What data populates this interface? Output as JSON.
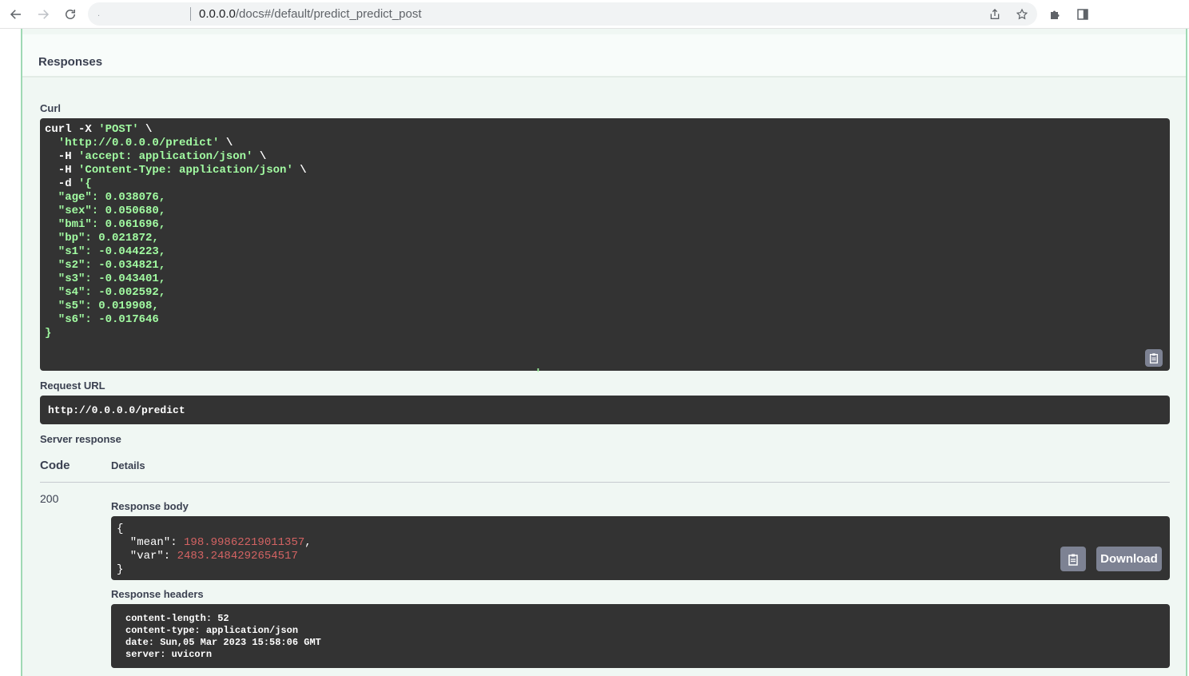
{
  "browser": {
    "url_prefix": ".",
    "url_host": "0.0.0.0",
    "url_path": "/docs#/default/predict_predict_post",
    "icons": [
      "back-arrow-icon",
      "forward-arrow-icon",
      "reload-icon",
      "share-icon",
      "star-icon",
      "extensions-puzzle-icon",
      "sidepanel-icon"
    ]
  },
  "responses": {
    "title": "Responses"
  },
  "curl": {
    "label": "Curl",
    "lines": [
      {
        "pre": "curl -X ",
        "str": "'POST'",
        "post": " \\"
      },
      {
        "pre": "  ",
        "str": "'http://0.0.0.0/predict'",
        "post": " \\"
      },
      {
        "pre": "  -H ",
        "str": "'accept: application/json'",
        "post": " \\"
      },
      {
        "pre": "  -H ",
        "str": "'Content-Type: application/json'",
        "post": " \\"
      },
      {
        "pre": "  -d ",
        "str": "'{",
        "post": ""
      },
      {
        "pre": "",
        "str": "  \"age\": 0.038076,",
        "post": ""
      },
      {
        "pre": "",
        "str": "  \"sex\": 0.050680,",
        "post": ""
      },
      {
        "pre": "",
        "str": "  \"bmi\": 0.061696,",
        "post": ""
      },
      {
        "pre": "",
        "str": "  \"bp\": 0.021872,",
        "post": ""
      },
      {
        "pre": "",
        "str": "  \"s1\": -0.044223,",
        "post": ""
      },
      {
        "pre": "",
        "str": "  \"s2\": -0.034821,",
        "post": ""
      },
      {
        "pre": "",
        "str": "  \"s3\": -0.043401,",
        "post": ""
      },
      {
        "pre": "",
        "str": "  \"s4\": -0.002592,",
        "post": ""
      },
      {
        "pre": "",
        "str": "  \"s5\": 0.019908,",
        "post": ""
      },
      {
        "pre": "",
        "str": "  \"s6\": -0.017646",
        "post": ""
      },
      {
        "pre": "",
        "str": "}",
        "post": ""
      },
      {
        "pre": "",
        "str": "",
        "post": ""
      },
      {
        "pre": "",
        "str": "",
        "post": ""
      },
      {
        "pre": "",
        "str": "                                                                         '",
        "post": ""
      }
    ]
  },
  "request_url": {
    "label": "Request URL",
    "value": "http://0.0.0.0/predict"
  },
  "server_response": {
    "label": "Server response",
    "code_header": "Code",
    "details_header": "Details",
    "status_code": "200",
    "body_label": "Response body",
    "body_open": "{",
    "body_lines": [
      {
        "key": "  \"mean\": ",
        "val": "198.99862219011357",
        "tail": ","
      },
      {
        "key": "  \"var\": ",
        "val": "2483.2484292654517",
        "tail": ""
      }
    ],
    "body_close": "}",
    "download_label": "Download",
    "headers_label": "Response headers",
    "headers": [
      "content-length: 52",
      "content-type: application/json",
      "date: Sun,05 Mar 2023 15:58:06 GMT",
      "server: uvicorn"
    ]
  }
}
